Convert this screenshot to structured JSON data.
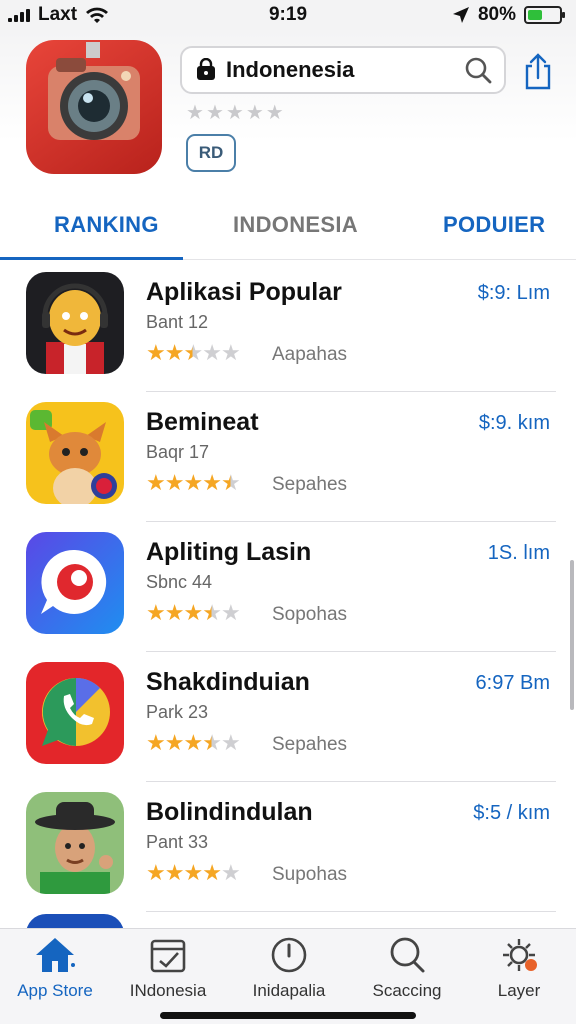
{
  "status_bar": {
    "carrier": "Laxt",
    "time": "9:19",
    "battery": "80%",
    "battery_level": 0.45
  },
  "header": {
    "search_text": "Indonenesia",
    "badge": "RD",
    "rating_stars": 0
  },
  "tabs": [
    {
      "label": "RANKING",
      "active": true
    },
    {
      "label": "INDONESIA",
      "active": false
    },
    {
      "label": "PODUIER",
      "active": false
    }
  ],
  "apps": [
    {
      "name": "Aplikasi Popular",
      "sub": "Bant 12",
      "category": "Aapahas",
      "price": "$:9: Lım",
      "rating": 2.5
    },
    {
      "name": "Bemineat",
      "sub": "Baqr 17",
      "category": "Sepahes",
      "price": "$:9. kım",
      "rating": 4.5
    },
    {
      "name": "Apliting Lasin",
      "sub": "Sbnc 44",
      "category": "Sopohas",
      "price": "1Ѕ. lım",
      "rating": 3.5
    },
    {
      "name": "Shakdinduian",
      "sub": "Park 23",
      "category": "Sepahes",
      "price": "6:97 Bm",
      "rating": 3.5
    },
    {
      "name": "Bolindindulan",
      "sub": "Pant 33",
      "category": "Supohas",
      "price": "$:5 / kım",
      "rating": 4
    }
  ],
  "tabbar": [
    {
      "label": "App Store",
      "icon": "home-icon",
      "active": true
    },
    {
      "label": "INdonesia",
      "icon": "calendar-icon",
      "active": false
    },
    {
      "label": "Inidapalia",
      "icon": "clock-icon",
      "active": false
    },
    {
      "label": "Scaccing",
      "icon": "search-icon",
      "active": false
    },
    {
      "label": "Layer",
      "icon": "sun-icon",
      "active": false
    }
  ],
  "colors": {
    "accent": "#1565c0",
    "star": "#f5a623",
    "star_off": "#cfcfd2"
  }
}
